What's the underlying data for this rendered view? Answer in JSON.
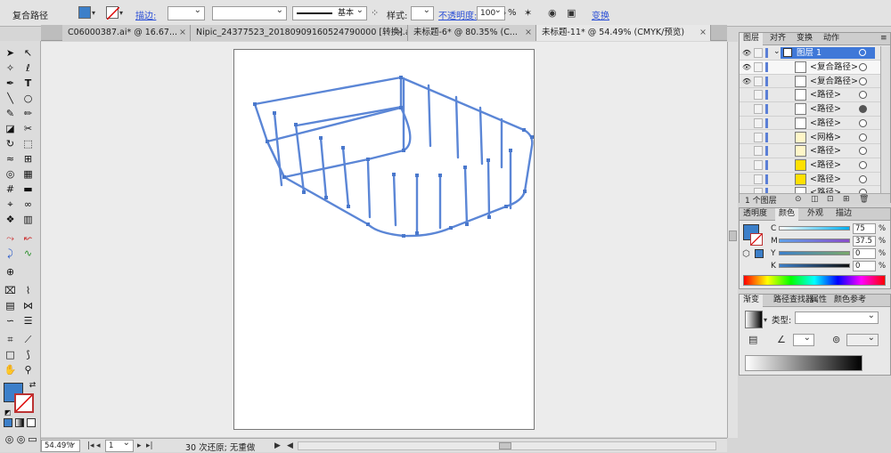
{
  "control_bar": {
    "selection_label": "复合路径",
    "fill_color": "#3c7fc9",
    "stroke_label": "描边:",
    "stroke_profile_label": "基本",
    "style_label": "样式:",
    "opacity_label": "不透明度:",
    "opacity_value": "100",
    "opacity_unit": "%",
    "transform_label": "变换"
  },
  "tabs": [
    {
      "label": "C06000387.ai* @ 16.67..."
    },
    {
      "label": "Nipic_24377523_20180909160524790000 [转换].ai*"
    },
    {
      "label": "未标题-6* @ 80.35% (C..."
    },
    {
      "label": "未标题-11* @ 54.49% (CMYK/预览)"
    }
  ],
  "status_bar": {
    "zoom": "54.49%",
    "page": "1",
    "history": "30 次还原; 无重做"
  },
  "layers_panel": {
    "tabs": [
      "图层",
      "对齐",
      "变换",
      "动作"
    ],
    "layer_name": "图层 1",
    "items": [
      {
        "name": "<复合路径>",
        "thumb": "#ffffff"
      },
      {
        "name": "<复合路径>",
        "thumb": "#ffffff"
      },
      {
        "name": "<路径>",
        "thumb": "#ffffff"
      },
      {
        "name": "<路径>",
        "thumb": "#ffffff"
      },
      {
        "name": "<路径>",
        "thumb": "#ffffff"
      },
      {
        "name": "<网格>",
        "thumb": "#fff6c8"
      },
      {
        "name": "<路径>",
        "thumb": "#fff6c8"
      },
      {
        "name": "<路径>",
        "thumb": "#ffe000"
      },
      {
        "name": "<路径>",
        "thumb": "#ffe000"
      },
      {
        "name": "<路径>",
        "thumb": "#ffffff"
      }
    ],
    "footer": "1 个图层"
  },
  "color_panel": {
    "tabs": [
      "透明度",
      "颜色",
      "外观",
      "描边"
    ],
    "channels": [
      {
        "label": "C",
        "value": "75",
        "unit": "%"
      },
      {
        "label": "M",
        "value": "37.5",
        "unit": "%"
      },
      {
        "label": "Y",
        "value": "0",
        "unit": "%"
      },
      {
        "label": "K",
        "value": "0",
        "unit": "%"
      }
    ],
    "fill_color": "#3c7fc9"
  },
  "gradient_panel": {
    "tabs": [
      "渐变",
      "路径查找器",
      "属性",
      "颜色参考"
    ],
    "type_label": "类型:"
  }
}
